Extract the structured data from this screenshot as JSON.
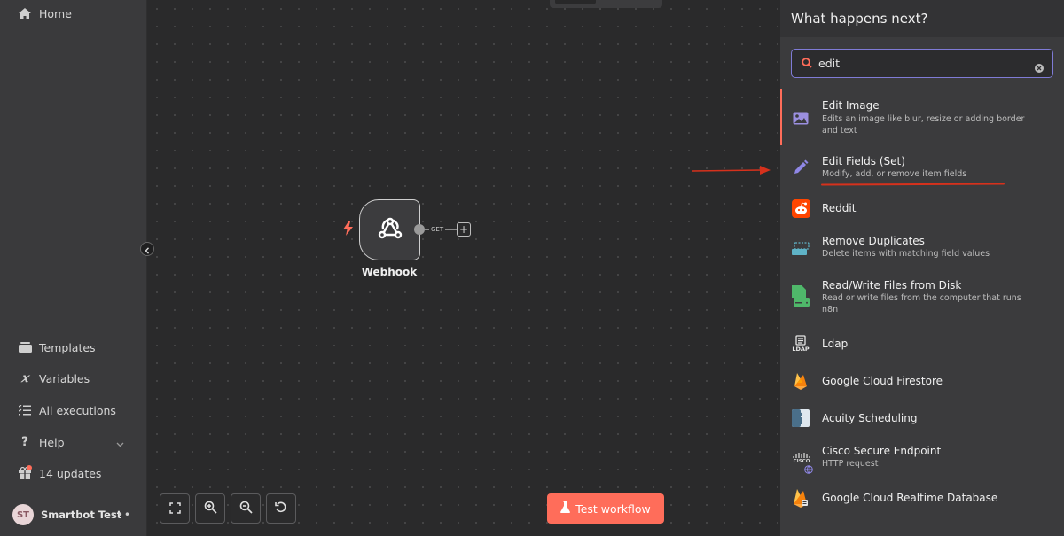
{
  "sidebar": {
    "home": "Home",
    "templates": "Templates",
    "variables": "Variables",
    "executions": "All executions",
    "help": "Help",
    "updates": "14 updates",
    "user_initials": "ST",
    "user_name": "Smartbot Test",
    "more": "•••"
  },
  "canvas": {
    "node_label": "Webhook",
    "connector_label": "GET",
    "test_button": "Test workflow"
  },
  "panel": {
    "title": "What happens next?",
    "search_value": "edit",
    "items": [
      {
        "title": "Edit Image",
        "desc": "Edits an image like blur, resize or adding border and text"
      },
      {
        "title": "Edit Fields (Set)",
        "desc": "Modify, add, or remove item fields"
      },
      {
        "title": "Reddit",
        "desc": ""
      },
      {
        "title": "Remove Duplicates",
        "desc": "Delete items with matching field values"
      },
      {
        "title": "Read/Write Files from Disk",
        "desc": "Read or write files from the computer that runs n8n"
      },
      {
        "title": "Ldap",
        "desc": ""
      },
      {
        "title": "Google Cloud Firestore",
        "desc": ""
      },
      {
        "title": "Acuity Scheduling",
        "desc": ""
      },
      {
        "title": "Cisco Secure Endpoint",
        "desc": "HTTP request"
      },
      {
        "title": "Google Cloud Realtime Database",
        "desc": ""
      }
    ],
    "ldap_icon_text": "LDAP",
    "cisco_icon_text": "CISCO"
  },
  "colors": {
    "accent": "#ff6d5a",
    "focus": "#7f7bd6",
    "annotation": "#d6311c"
  }
}
